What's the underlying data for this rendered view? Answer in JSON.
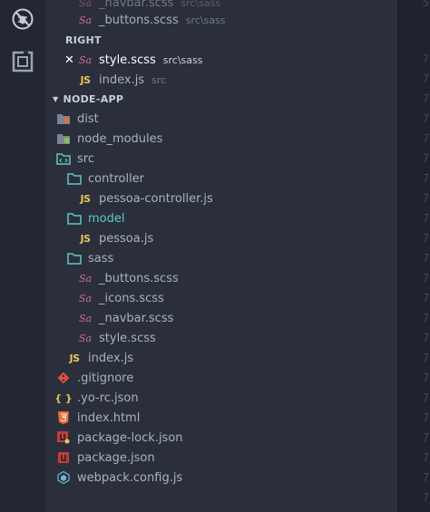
{
  "activity_bar": {
    "items": [
      {
        "name": "debug-icon"
      },
      {
        "name": "extensions-icon"
      }
    ]
  },
  "open_editors": {
    "left": [
      {
        "label": "_navbar.scss",
        "path": "src\\sass",
        "icon": "sass-icon"
      },
      {
        "label": "_buttons.scss",
        "path": "src\\sass",
        "icon": "sass-icon"
      }
    ],
    "right_label": "RIGHT",
    "right": [
      {
        "label": "style.scss",
        "path": "src\\sass",
        "icon": "sass-icon",
        "close": "✕"
      },
      {
        "label": "index.js",
        "path": "src",
        "icon": "js-icon"
      }
    ]
  },
  "project": {
    "title": "NODE-APP",
    "tree": [
      {
        "label": "dist",
        "icon": "folder-dist-icon"
      },
      {
        "label": "node_modules",
        "icon": "folder-node-icon"
      },
      {
        "label": "src",
        "icon": "folder-src-icon"
      },
      {
        "label": "controller",
        "icon": "folder-icon"
      },
      {
        "label": "pessoa-controller.js",
        "icon": "js-icon"
      },
      {
        "label": "model",
        "icon": "folder-icon"
      },
      {
        "label": "pessoa.js",
        "icon": "js-icon"
      },
      {
        "label": "sass",
        "icon": "folder-icon"
      },
      {
        "label": "_buttons.scss",
        "icon": "sass-icon"
      },
      {
        "label": "_icons.scss",
        "icon": "sass-icon"
      },
      {
        "label": "_navbar.scss",
        "icon": "sass-icon"
      },
      {
        "label": "style.scss",
        "icon": "sass-icon"
      },
      {
        "label": "index.js",
        "icon": "js-icon"
      },
      {
        "label": ".gitignore",
        "icon": "git-icon"
      },
      {
        "label": ".yo-rc.json",
        "icon": "json-icon"
      },
      {
        "label": "index.html",
        "icon": "html-icon"
      },
      {
        "label": "package-lock.json",
        "icon": "npm-icon"
      },
      {
        "label": "package.json",
        "icon": "npm-icon"
      },
      {
        "label": "webpack.config.js",
        "icon": "webpack-icon"
      }
    ]
  },
  "icons": {
    "js_text": "JS",
    "sass_text": "Sa",
    "json_text": "{ }"
  },
  "colors": {
    "js": "#e8c55c",
    "sass": "#cf6f98",
    "folder": "#5fc8c4",
    "git": "#e0533b",
    "json": "#e8c55c",
    "html": "#e86e35",
    "npm": "#c63a3a",
    "webpack": "#6fb6d8"
  },
  "gutter": {
    "line_number": "7",
    "first_line": "5"
  }
}
